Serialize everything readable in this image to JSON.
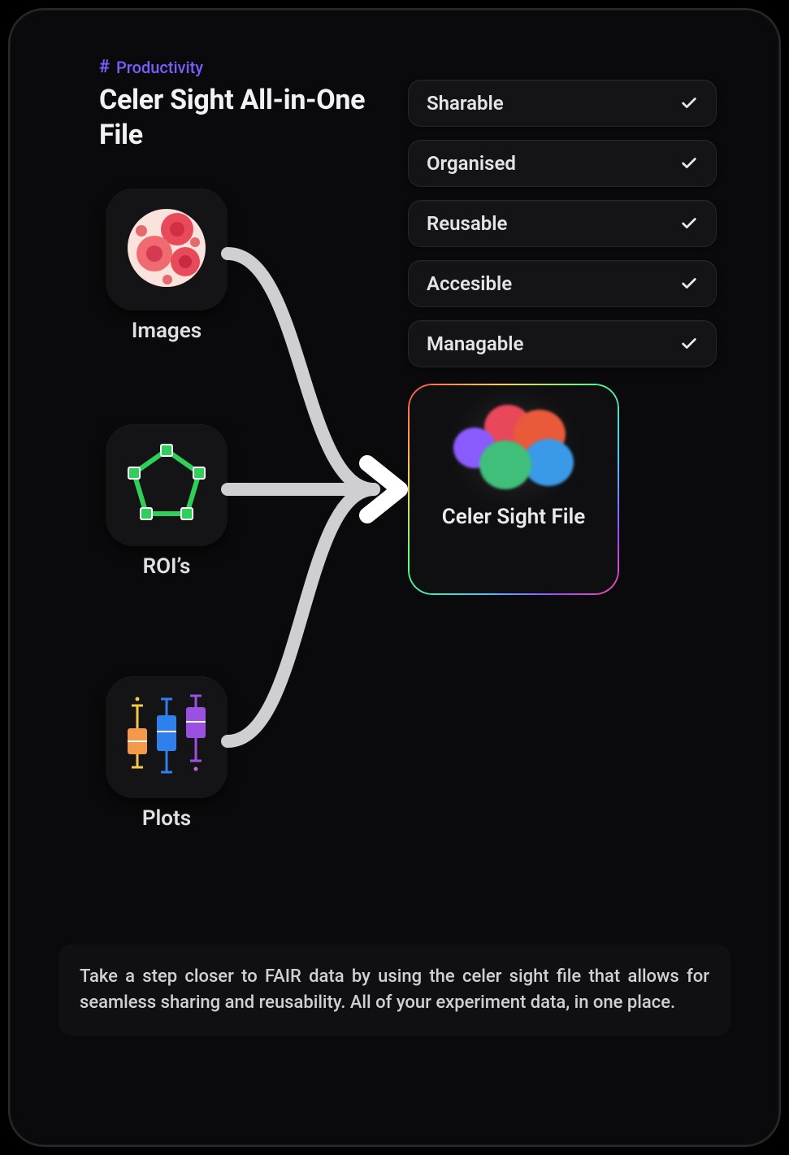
{
  "tag": {
    "hash": "#",
    "label": "Productivity"
  },
  "title": "Celer Sight  All-in-One File",
  "features": [
    {
      "label": "Sharable",
      "checked": true
    },
    {
      "label": "Organised",
      "checked": true
    },
    {
      "label": "Reusable",
      "checked": true
    },
    {
      "label": "Accesible",
      "checked": true
    },
    {
      "label": "Managable",
      "checked": true
    }
  ],
  "sources": {
    "images": {
      "label": "Images",
      "icon": "cells-icon"
    },
    "rois": {
      "label": "ROI’s",
      "icon": "polygon-icon"
    },
    "plots": {
      "label": "Plots",
      "icon": "boxplot-icon"
    }
  },
  "target": {
    "label": "Celer Sight File",
    "icon": "color-blob-icon"
  },
  "footer_text": "Take a step closer to FAIR data by using the celer sight file that allows for seamless sharing and reusability.  All of your experiment data, in one place."
}
